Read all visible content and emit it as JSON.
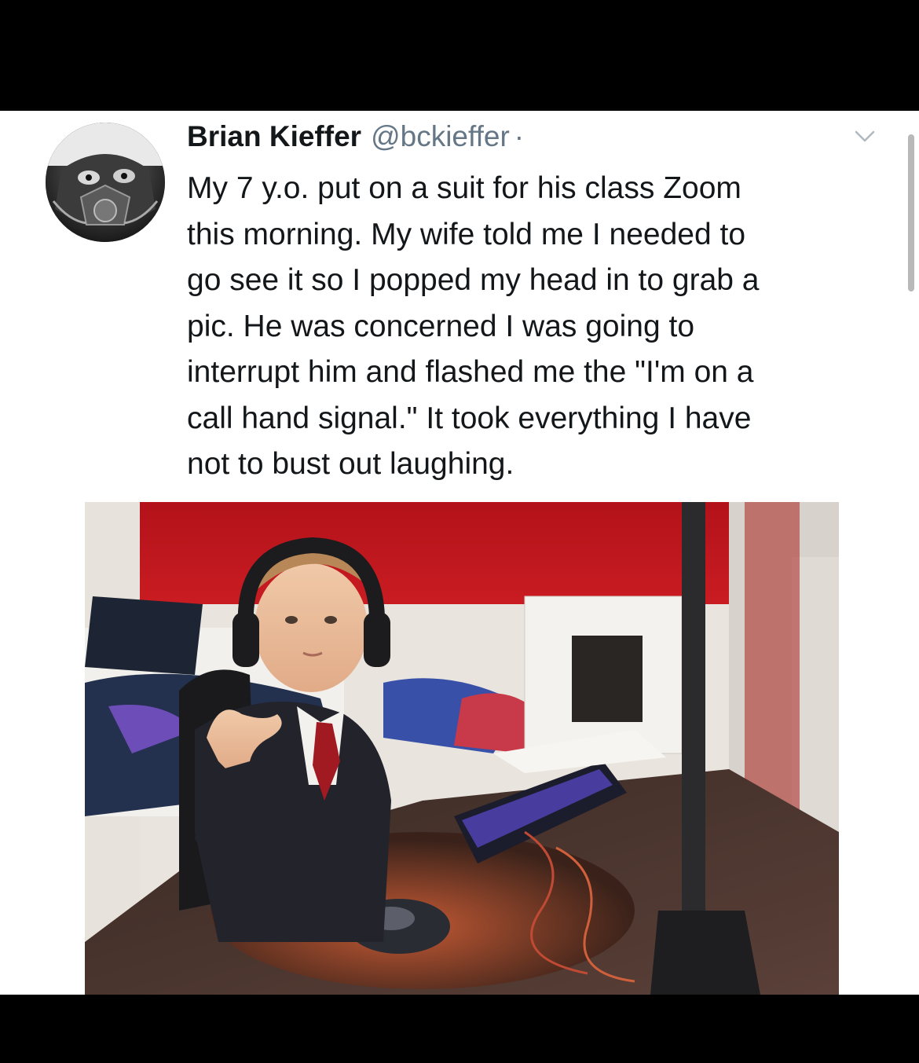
{
  "tweet": {
    "author": {
      "name": "Brian Kieffer",
      "handle": "@bckieffer",
      "separator": "·",
      "avatar_icon": "avatar-icon"
    },
    "menu_icon": "chevron-down-icon",
    "text_lines": [
      "My 7 y.o. put on a suit for his class Zoom",
      "this morning. My wife told me I needed to",
      "go see it so I popped my head in to grab a",
      "pic. He was concerned I was going to",
      "interrupt him and flashed me the \"I'm on a",
      "call hand signal.\" It took everything I have",
      "not to bust out laughing."
    ],
    "photo_icon": "attached-photo"
  },
  "colors": {
    "name": "#14171a",
    "handle": "#657786",
    "background": "#ffffff",
    "frame": "#000000",
    "wall_red": "#c0151c"
  }
}
